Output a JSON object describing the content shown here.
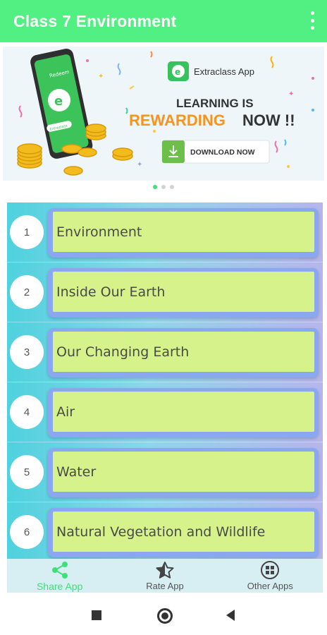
{
  "app_bar": {
    "title": "Class 7 Environment",
    "menu_icon": "more-vert-icon"
  },
  "banner": {
    "brand": "Extraclass App",
    "headline_line1": "LEARNING IS",
    "headline_rewarding": "REWARDING",
    "headline_now": "NOW !!",
    "download_label": "DOWNLOAD NOW",
    "phone_top_text": "Redeem",
    "phone_bottom_text": "Extraclass",
    "colors": {
      "orange": "#f7941d",
      "green": "#3fb549",
      "dark": "#333333"
    }
  },
  "carousel": {
    "pages": 3,
    "active": 1
  },
  "chapters": [
    {
      "number": "1",
      "title": "Environment"
    },
    {
      "number": "2",
      "title": "Inside Our Earth"
    },
    {
      "number": "3",
      "title": "Our Changing Earth"
    },
    {
      "number": "4",
      "title": "Air"
    },
    {
      "number": "5",
      "title": "Water"
    },
    {
      "number": "6",
      "title": "Natural Vegetation and Wildlife"
    }
  ],
  "bottom_nav": [
    {
      "label": "Share App",
      "icon": "share-icon",
      "active": true
    },
    {
      "label": "Rate App",
      "icon": "star-rate-icon",
      "active": false
    },
    {
      "label": "Other Apps",
      "icon": "grid-apps-icon",
      "active": false
    }
  ],
  "system_nav": {
    "icons": [
      "recents-icon",
      "home-icon",
      "back-icon"
    ]
  },
  "colors": {
    "appbar": "#52ef83",
    "card_fill": "#d5f38a",
    "card_border": "#8aa8f0",
    "accent": "#3ee07a"
  }
}
